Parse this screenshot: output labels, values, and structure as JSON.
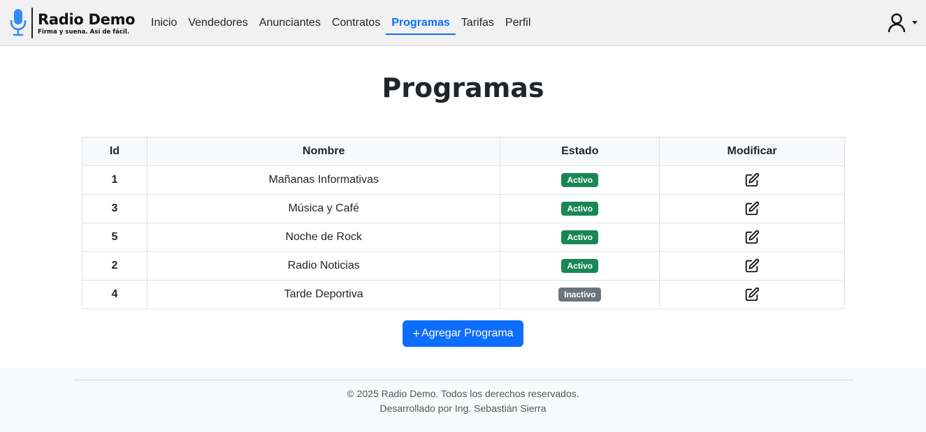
{
  "brand": {
    "title": "Radio Demo",
    "tagline": "Firma y suena. Así de fácil."
  },
  "nav": {
    "items": [
      {
        "label": "Inicio"
      },
      {
        "label": "Vendedores"
      },
      {
        "label": "Anunciantes"
      },
      {
        "label": "Contratos"
      },
      {
        "label": "Programas",
        "active": true
      },
      {
        "label": "Tarifas"
      },
      {
        "label": "Perfil"
      }
    ]
  },
  "user_menu": {
    "icon": "user-icon"
  },
  "page": {
    "title": "Programas"
  },
  "table": {
    "headers": {
      "id": "Id",
      "name": "Nombre",
      "state": "Estado",
      "modify": "Modificar"
    },
    "rows": [
      {
        "id": "1",
        "name": "Mañanas Informativas",
        "state": "Activo"
      },
      {
        "id": "3",
        "name": "Música y Café",
        "state": "Activo"
      },
      {
        "id": "5",
        "name": "Noche de Rock",
        "state": "Activo"
      },
      {
        "id": "2",
        "name": "Radio Noticias",
        "state": "Activo"
      },
      {
        "id": "4",
        "name": "Tarde Deportiva",
        "state": "Inactivo"
      }
    ]
  },
  "add_button": {
    "plus": "+",
    "label": "Agregar Programa"
  },
  "footer": {
    "copyright": "© 2025 Radio Demo. Todos los derechos reservados.",
    "credits": "Desarrollado por Ing. Sebastián Sierra"
  },
  "colors": {
    "primary": "#0d6efd",
    "active_badge": "#198754",
    "inactive_badge": "#6c757d",
    "logo_mic": "#2f8cf5"
  }
}
